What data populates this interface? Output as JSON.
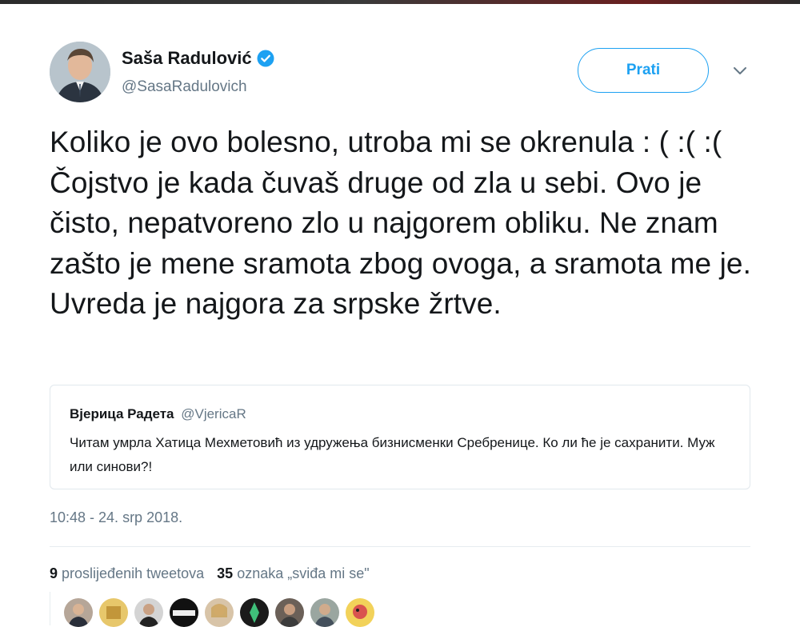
{
  "user": {
    "name": "Saša Radulović",
    "handle": "@SasaRadulovich",
    "verified": true
  },
  "follow_label": "Prati",
  "tweet_text": "Koliko je ovo bolesno, utroba mi se okrenula : ( :( :( Čojstvo je kada čuvaš druge od zla u sebi. Ovo je čisto, nepatvoreno zlo u najgorem obliku. Ne znam zašto je mene sramota zbog ovoga, a sramota me je. Uvreda je najgora za srpske žrtve.",
  "quoted": {
    "name": "Вјерица Радета",
    "handle": "@VjericaR",
    "text": "Читам умрла Хатица Мехметовић из удружења бизнисменки Сребренице. Ко ли ће је сахранити. Муж или синови?!"
  },
  "timestamp": "10:48 - 24. srp 2018.",
  "stats": {
    "retweets_count": "9",
    "retweets_label": "proslijeđenih tweetova",
    "likes_count": "35",
    "likes_label": "oznaka „sviđa mi se\""
  },
  "colors": {
    "accent": "#1da1f2",
    "muted": "#657786",
    "text": "#14171a",
    "border": "#e1e8ed"
  },
  "icons": [
    "verified-badge-icon",
    "chevron-down-icon"
  ],
  "likers_count_shown": 9
}
